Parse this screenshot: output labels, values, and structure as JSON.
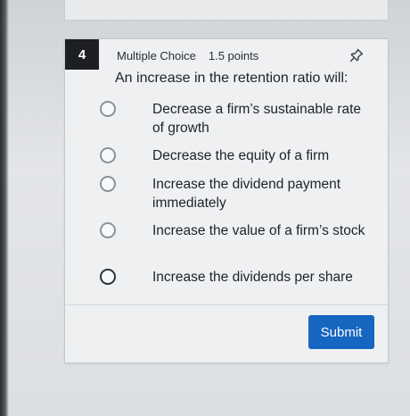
{
  "question": {
    "number": "4",
    "type": "Multiple Choice",
    "points": "1.5 points",
    "prompt": "An increase in the retention ratio will:"
  },
  "options": [
    {
      "label": "Decrease a firm’s sustainable rate of growth"
    },
    {
      "label": "Decrease the equity of a firm"
    },
    {
      "label": "Increase the dividend payment immediately"
    },
    {
      "label": "Increase the value of a firm’s stock"
    },
    {
      "label": "Increase the dividends per share"
    }
  ],
  "actions": {
    "submit_label": "Submit"
  },
  "icons": {
    "pin": "pin-icon",
    "radio": "radio-unselected-icon"
  },
  "colors": {
    "submit_bg": "#1566c0",
    "qnum_bg": "#1d1f22"
  }
}
